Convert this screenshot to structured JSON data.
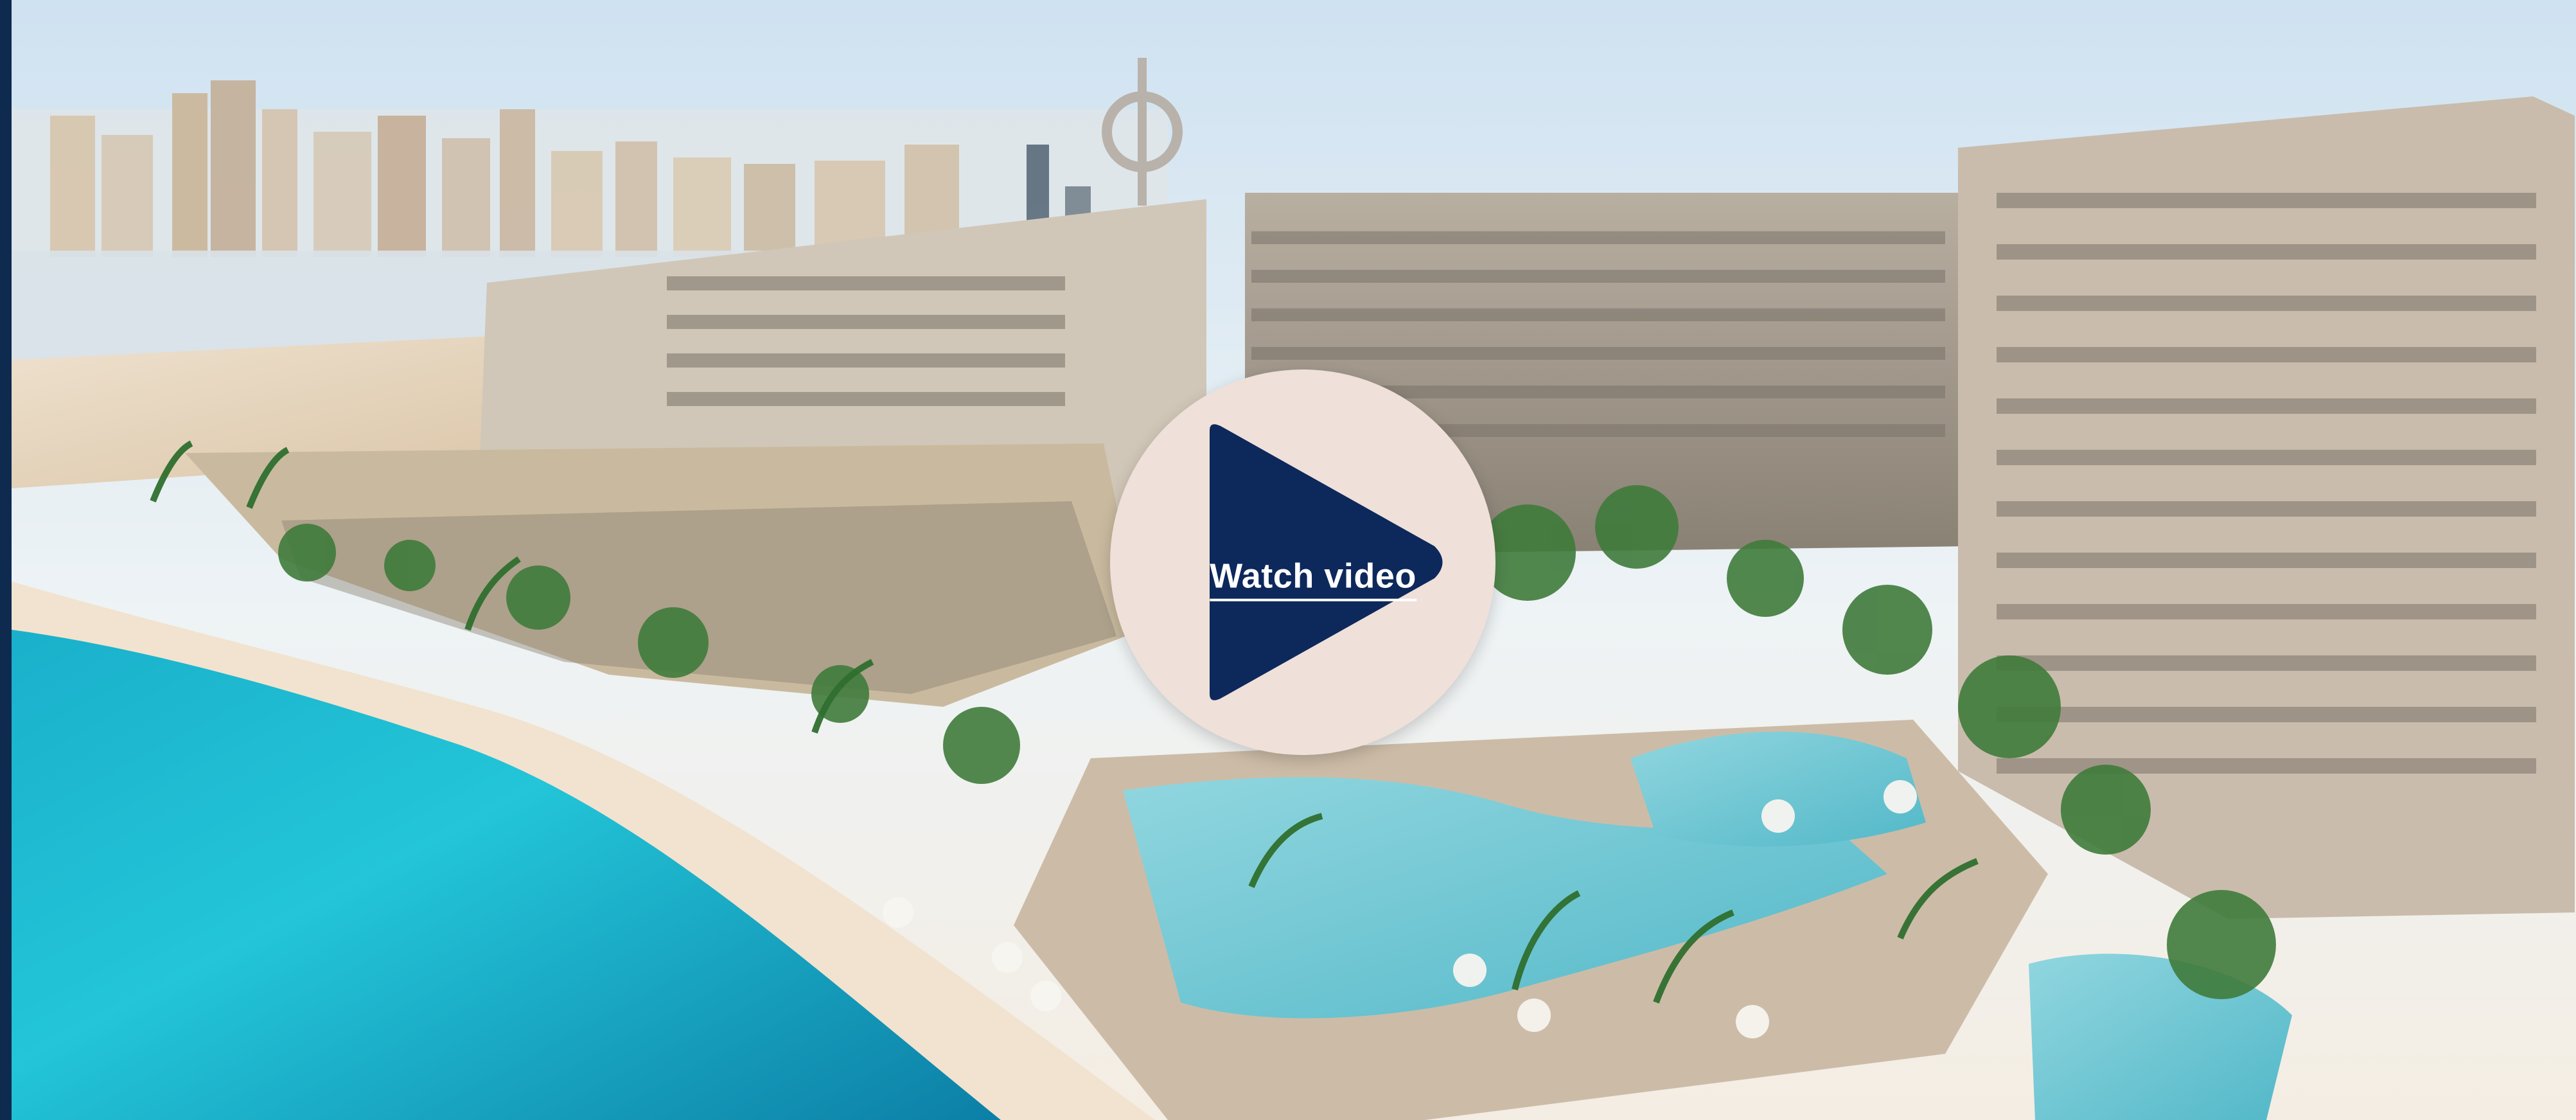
{
  "video_card": {
    "play_button": {
      "label": "Watch video",
      "icon": "play-icon"
    }
  },
  "colors": {
    "frame": "#0f2a4f",
    "play_circle": "#efe0da",
    "play_triangle": "#0d285b",
    "play_text": "#ffffff"
  }
}
